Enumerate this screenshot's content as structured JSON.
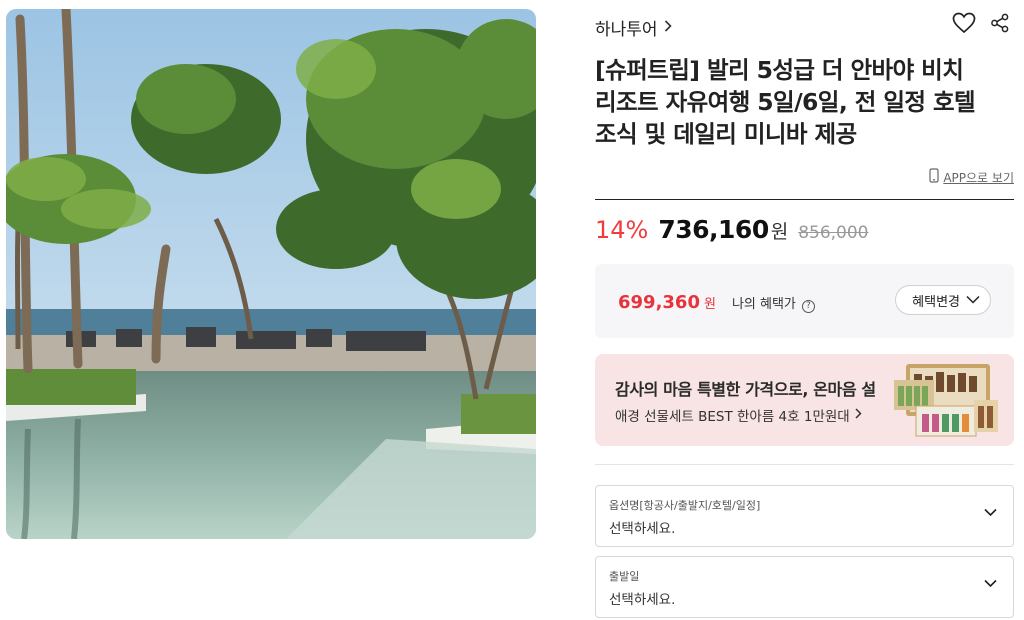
{
  "product": {
    "image_alt": "리조트 수영장과 야자수, 바다 전경",
    "brand": "하나투어",
    "title": "[슈퍼트립] 발리 5성급 더 안바야 비치 리조트 자유여행 5일/6일, 전 일정 호텔 조식 및 데일리 미니바 제공",
    "app_link": "APP으로 보기"
  },
  "pricing": {
    "discount": "14%",
    "price": "736,160",
    "price_unit": "원",
    "original": "856,000"
  },
  "benefit": {
    "price": "699,360",
    "unit": "원",
    "label": "나의 혜택가",
    "change_button": "혜택변경"
  },
  "banner": {
    "title": "감사의 마음 특별한 가격으로, 온마음 설",
    "subtitle": "애경 선물세트 BEST 한아름 4호 1만원대"
  },
  "options": [
    {
      "label": "옵션명[항공사/출발지/호텔/일정]",
      "value": "선택하세요."
    },
    {
      "label": "출발일",
      "value": "선택하세요."
    }
  ],
  "icons": {
    "brand_chevron": "chevron-right-icon",
    "wishlist": "heart-icon",
    "share": "share-icon",
    "app": "smartphone-icon",
    "help": "question-circle-icon",
    "dropdown": "chevron-down-icon"
  },
  "colors": {
    "discount": "#f03c3c",
    "benefit_price": "#e8323c",
    "banner_bg": "#f8e4e4",
    "benefit_bg": "#f6f6f8"
  }
}
